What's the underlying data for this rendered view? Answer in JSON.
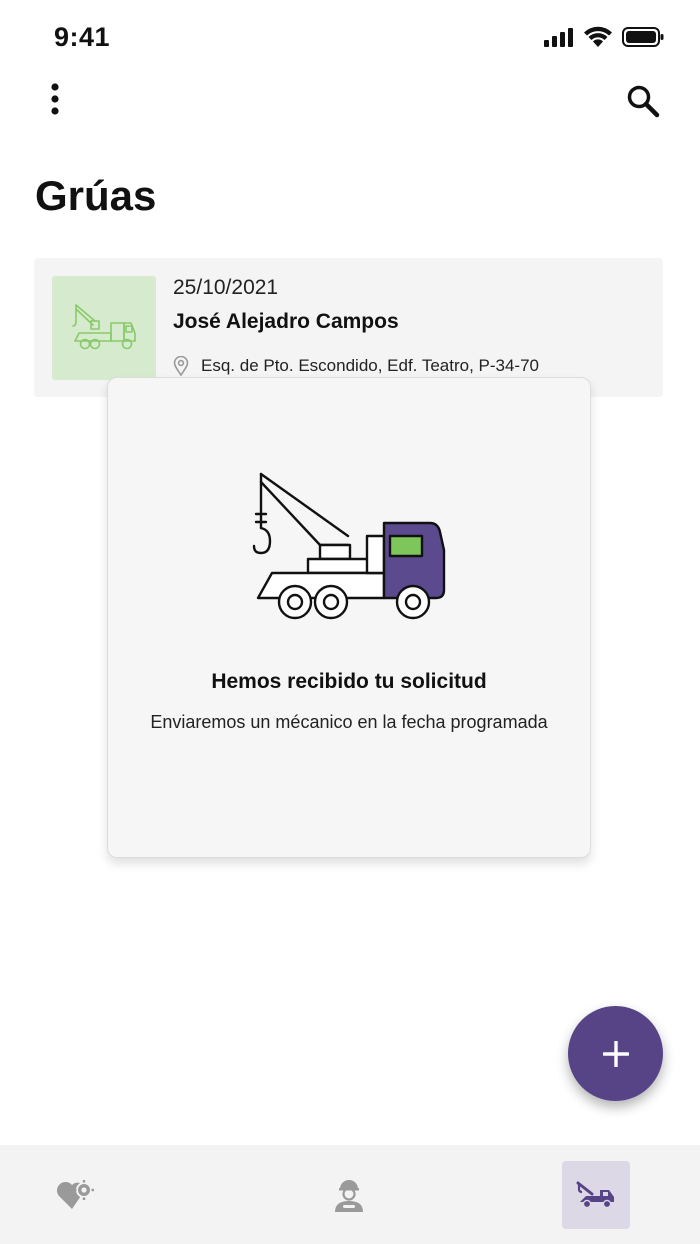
{
  "status_bar": {
    "time": "9:41"
  },
  "header": {
    "title": "Grúas"
  },
  "request_card": {
    "date": "25/10/2021",
    "name": "José Alejadro Campos",
    "address": "Esq. de Pto. Escondido, Edf. Teatro, P-34-70"
  },
  "dialog": {
    "title": "Hemos recibido tu solicitud",
    "message": "Enviaremos un mécanico en la fecha programada"
  },
  "colors": {
    "accent": "#564486",
    "thumb_bg": "#d6ebcd",
    "truck_cab": "#5b4a8d",
    "truck_window": "#7fc65a"
  },
  "icons": {
    "menu": "more-vertical-icon",
    "search": "search-icon",
    "location": "location-pin-icon",
    "fab": "plus-icon",
    "nav": [
      "heart-gear-icon",
      "mechanic-icon",
      "tow-truck-icon"
    ]
  },
  "bottom_nav": {
    "active_index": 2
  }
}
